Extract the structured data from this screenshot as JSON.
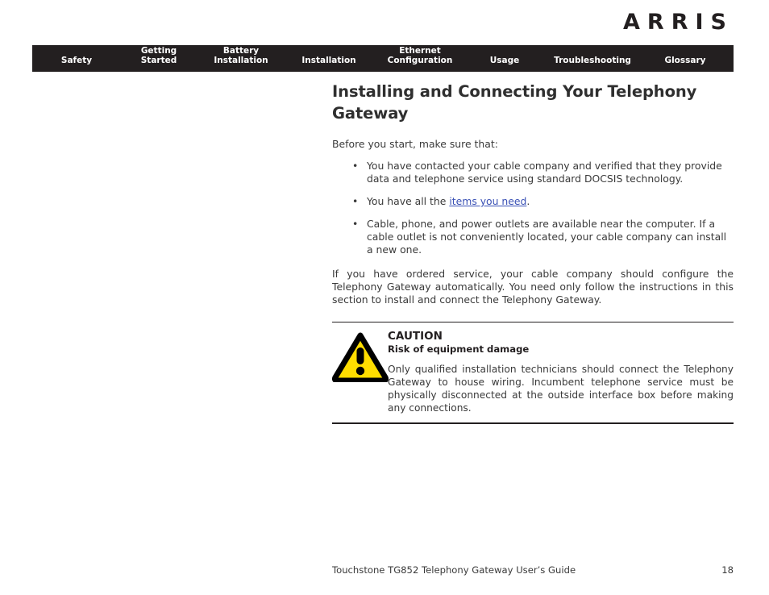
{
  "brand": {
    "logo_text": "ARRIS"
  },
  "nav": {
    "items": [
      {
        "label": "Safety"
      },
      {
        "label": "Getting\nStarted"
      },
      {
        "label": "Battery\nInstallation"
      },
      {
        "label": "Installation"
      },
      {
        "label": "Ethernet\nConfiguration"
      },
      {
        "label": "Usage"
      },
      {
        "label": "Troubleshooting"
      },
      {
        "label": "Glossary"
      }
    ]
  },
  "main": {
    "title": "Installing and Connecting Your Telephony Gateway",
    "intro": "Before you start, make sure that:",
    "checklist": [
      {
        "text": "You have contacted your cable company and verified that they provide data and telephone service using standard DOCSIS technology."
      },
      {
        "text_before": "You have all the ",
        "link_text": "items you need",
        "text_after": "."
      },
      {
        "text": "Cable, phone, and power outlets are available near the computer. If a cable outlet is not conveniently located, your cable company can install a new one."
      }
    ],
    "paragraph": "If you have ordered service, your cable company should configure the Telephony Gateway automatically. You need only follow the instructions in this section to install and connect the Telephony Gateway."
  },
  "caution": {
    "title": "CAUTION",
    "subtitle": "Risk of equipment damage",
    "text": "Only qualified installation technicians should connect the Telephony Gateway to house wiring. Incumbent telephone service must be physically disconnected at the outside interface box before making any connections.",
    "icon": "warning-triangle-icon",
    "icon_fill": "#ffdd00",
    "icon_stroke": "#000000"
  },
  "footer": {
    "document_title": "Touchstone TG852 Telephony Gateway User’s Guide",
    "page_number": "18"
  },
  "colors": {
    "nav_background": "#231f20",
    "link": "#3a51b5",
    "body_text": "#3a3a3a",
    "heading": "#2f2f2f"
  }
}
